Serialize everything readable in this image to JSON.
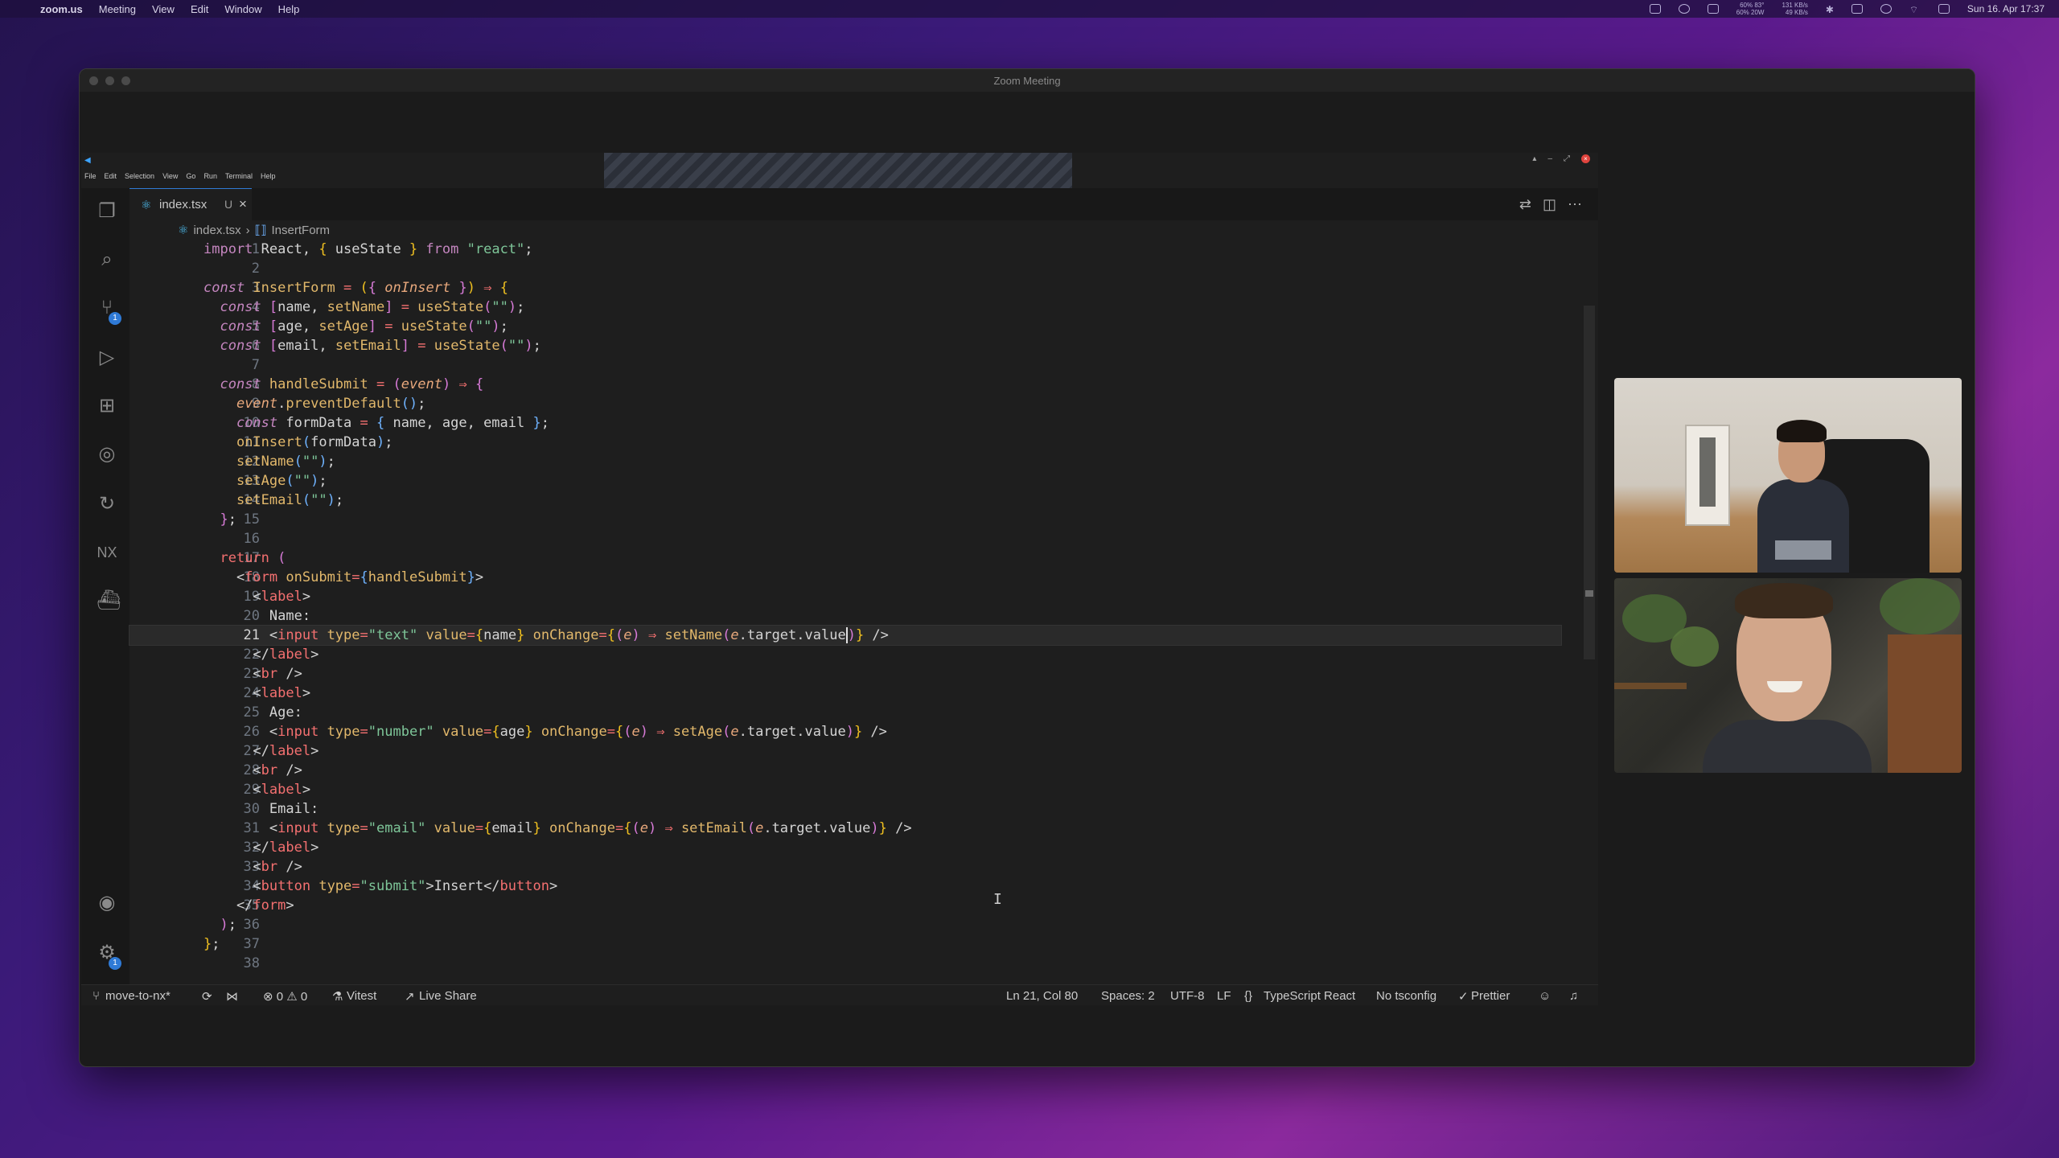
{
  "menubar": {
    "app": "zoom.us",
    "items": [
      "Meeting",
      "View",
      "Edit",
      "Window",
      "Help"
    ],
    "tray_stats": [
      "60% 83°\n60% 20W",
      "131 KB/s\n49 KB/s"
    ],
    "clock": "Sun 16. Apr 17:37"
  },
  "zoom": {
    "title": "Zoom Meeting"
  },
  "vscode": {
    "menu": [
      "File",
      "Edit",
      "Selection",
      "View",
      "Go",
      "Run",
      "Terminal",
      "Help"
    ],
    "tab": {
      "label": "index.tsx",
      "status": "U",
      "close": "×"
    },
    "breadcrumb": {
      "file": "index.tsx",
      "separator": "›",
      "symbol": "InsertForm"
    },
    "activity_badges": {
      "source_control": "1",
      "settings": "1"
    },
    "code_lines": [
      "1",
      "2",
      "3",
      "4",
      "5",
      "6",
      "7",
      "8",
      "9",
      "10",
      "11",
      "12",
      "13",
      "14",
      "15",
      "16",
      "17",
      "18",
      "19",
      "20",
      "21",
      "22",
      "23",
      "24",
      "25",
      "26",
      "27",
      "28",
      "29",
      "30",
      "31",
      "32",
      "33",
      "34",
      "35",
      "36",
      "37",
      "38"
    ],
    "current_line": 21,
    "status": {
      "branch": "move-to-nx*",
      "problems": "⊗ 0 ⚠ 0",
      "vitest": "Vitest",
      "live_share": "Live Share",
      "position": "Ln 21, Col 80",
      "spaces": "Spaces: 2",
      "encoding": "UTF-8",
      "eol": "LF",
      "language": "TypeScript React",
      "tsconfig": "No tsconfig",
      "prettier": "Prettier"
    }
  },
  "colors": {
    "accent": "#2f7ad6",
    "keyword": "#c586c0",
    "string": "#7ec699",
    "function": "#e2b86b",
    "tag": "#f47070"
  }
}
